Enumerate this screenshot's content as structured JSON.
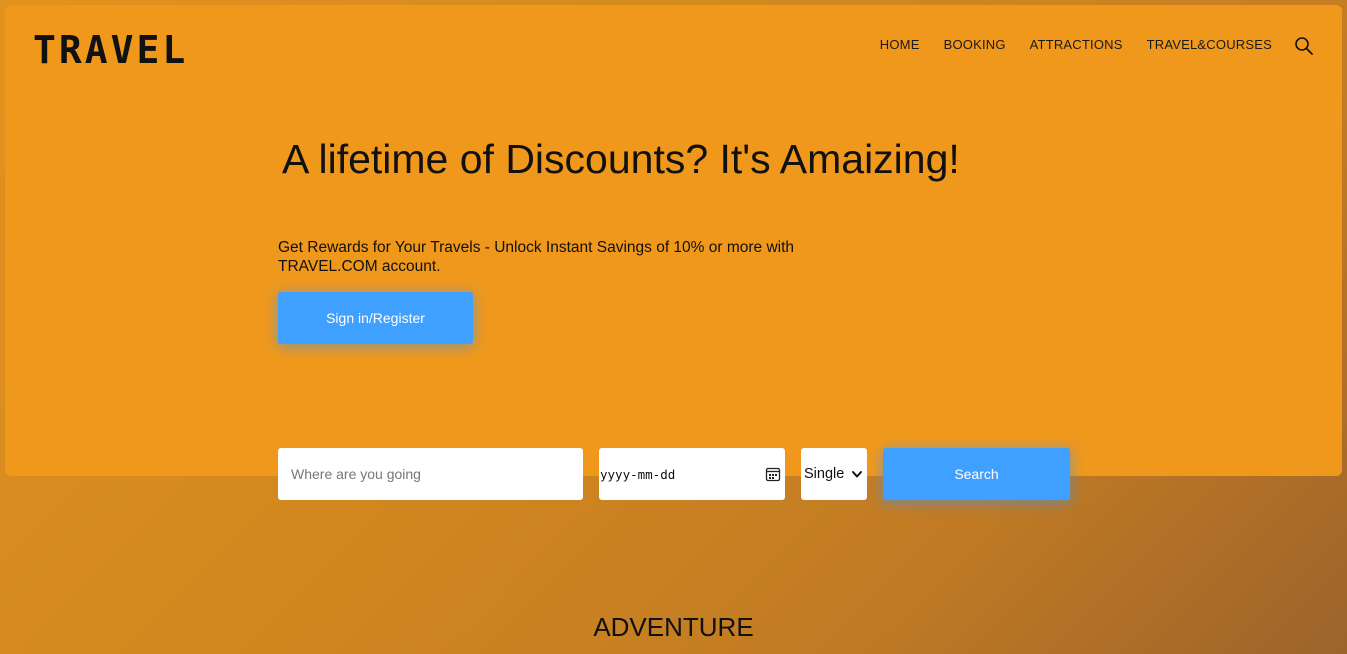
{
  "brand": {
    "logo": "TRAVEL"
  },
  "nav": {
    "items": [
      "HOME",
      "BOOKING",
      "ATTRACTIONS",
      "TRAVEL&COURSES"
    ],
    "search_icon": "search-icon"
  },
  "hero": {
    "title": "A lifetime of Discounts? It's Amaizing!",
    "subtext": "Get Rewards for Your Travels - Unlock Instant Savings of 10% or more with TRAVEL.COM account.",
    "cta_label": "Sign in/Register"
  },
  "search": {
    "destination_placeholder": "Where are you going",
    "destination_value": "",
    "date_placeholder": "yyyy-mm-dd",
    "trip_type_selected": "Single",
    "submit_label": "Search"
  },
  "sections": {
    "first_title": "ADVENTURE"
  },
  "colors": {
    "hero_bg": "#f0981c",
    "accent_button": "#3fa0ff",
    "page_gradient_end": "#9c632b"
  }
}
